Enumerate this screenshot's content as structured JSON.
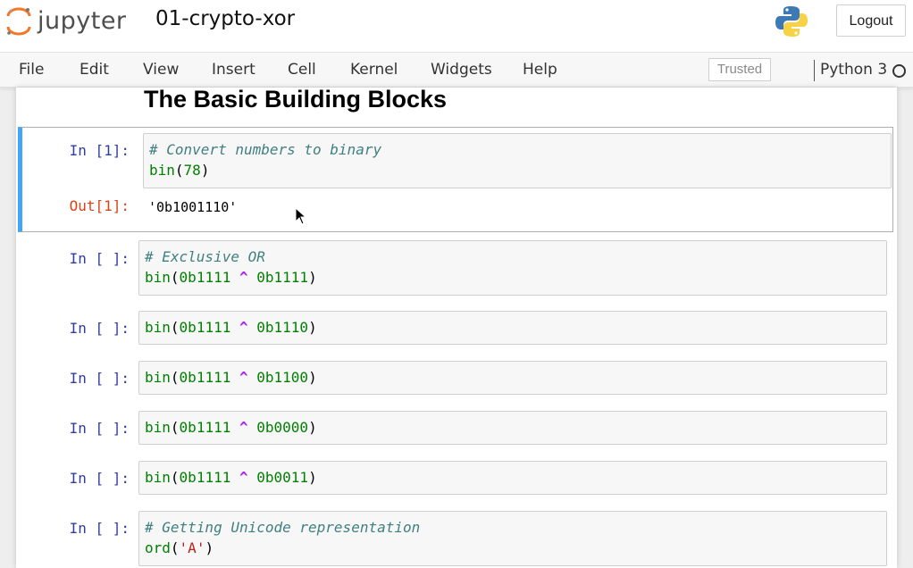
{
  "header": {
    "logo_text": "jupyter",
    "notebook_title": "01-crypto-xor",
    "logout_label": "Logout"
  },
  "menubar": {
    "items": [
      "File",
      "Edit",
      "View",
      "Insert",
      "Cell",
      "Kernel",
      "Widgets",
      "Help"
    ],
    "trusted_label": "Trusted",
    "kernel_name": "Python 3"
  },
  "notebook": {
    "heading": "The Basic Building Blocks",
    "cells": [
      {
        "in_prompt": "In [1]:",
        "lines": [
          [
            {
              "t": "# Convert numbers to binary",
              "c": "comment"
            }
          ],
          [
            {
              "t": "bin",
              "c": "builtin"
            },
            {
              "t": "(",
              "c": "paren"
            },
            {
              "t": "78",
              "c": "number"
            },
            {
              "t": ")",
              "c": "paren"
            }
          ]
        ],
        "out_prompt": "Out[1]:",
        "output": "'0b1001110'"
      },
      {
        "in_prompt": "In [ ]:",
        "lines": [
          [
            {
              "t": "# Exclusive OR",
              "c": "comment"
            }
          ],
          [
            {
              "t": "bin",
              "c": "builtin"
            },
            {
              "t": "(",
              "c": "paren"
            },
            {
              "t": "0b1111",
              "c": "number"
            },
            {
              "t": " ",
              "c": "paren"
            },
            {
              "t": "^",
              "c": "op"
            },
            {
              "t": " ",
              "c": "paren"
            },
            {
              "t": "0b1111",
              "c": "number"
            },
            {
              "t": ")",
              "c": "paren"
            }
          ]
        ]
      },
      {
        "in_prompt": "In [ ]:",
        "lines": [
          [
            {
              "t": "bin",
              "c": "builtin"
            },
            {
              "t": "(",
              "c": "paren"
            },
            {
              "t": "0b1111",
              "c": "number"
            },
            {
              "t": " ",
              "c": "paren"
            },
            {
              "t": "^",
              "c": "op"
            },
            {
              "t": " ",
              "c": "paren"
            },
            {
              "t": "0b1110",
              "c": "number"
            },
            {
              "t": ")",
              "c": "paren"
            }
          ]
        ]
      },
      {
        "in_prompt": "In [ ]:",
        "lines": [
          [
            {
              "t": "bin",
              "c": "builtin"
            },
            {
              "t": "(",
              "c": "paren"
            },
            {
              "t": "0b1111",
              "c": "number"
            },
            {
              "t": " ",
              "c": "paren"
            },
            {
              "t": "^",
              "c": "op"
            },
            {
              "t": " ",
              "c": "paren"
            },
            {
              "t": "0b1100",
              "c": "number"
            },
            {
              "t": ")",
              "c": "paren"
            }
          ]
        ]
      },
      {
        "in_prompt": "In [ ]:",
        "lines": [
          [
            {
              "t": "bin",
              "c": "builtin"
            },
            {
              "t": "(",
              "c": "paren"
            },
            {
              "t": "0b1111",
              "c": "number"
            },
            {
              "t": " ",
              "c": "paren"
            },
            {
              "t": "^",
              "c": "op"
            },
            {
              "t": " ",
              "c": "paren"
            },
            {
              "t": "0b0000",
              "c": "number"
            },
            {
              "t": ")",
              "c": "paren"
            }
          ]
        ]
      },
      {
        "in_prompt": "In [ ]:",
        "lines": [
          [
            {
              "t": "bin",
              "c": "builtin"
            },
            {
              "t": "(",
              "c": "paren"
            },
            {
              "t": "0b1111",
              "c": "number"
            },
            {
              "t": " ",
              "c": "paren"
            },
            {
              "t": "^",
              "c": "op"
            },
            {
              "t": " ",
              "c": "paren"
            },
            {
              "t": "0b0011",
              "c": "number"
            },
            {
              "t": ")",
              "c": "paren"
            }
          ]
        ]
      },
      {
        "in_prompt": "In [ ]:",
        "lines": [
          [
            {
              "t": "# Getting Unicode representation",
              "c": "comment"
            }
          ],
          [
            {
              "t": "ord",
              "c": "builtin"
            },
            {
              "t": "(",
              "c": "paren"
            },
            {
              "t": "'A'",
              "c": "string"
            },
            {
              "t": ")",
              "c": "paren"
            }
          ]
        ]
      }
    ]
  },
  "colors": {
    "accent_selected_border": "#42a5f5",
    "in_prompt": "#303f9f",
    "out_prompt": "#d84315",
    "jupyter_orange": "#f37726"
  },
  "icons": {
    "logo": "jupyter-logo-icon",
    "python": "python-logo-icon",
    "kernel_status": "kernel-idle-circle-icon",
    "cursor": "mouse-pointer-icon"
  }
}
